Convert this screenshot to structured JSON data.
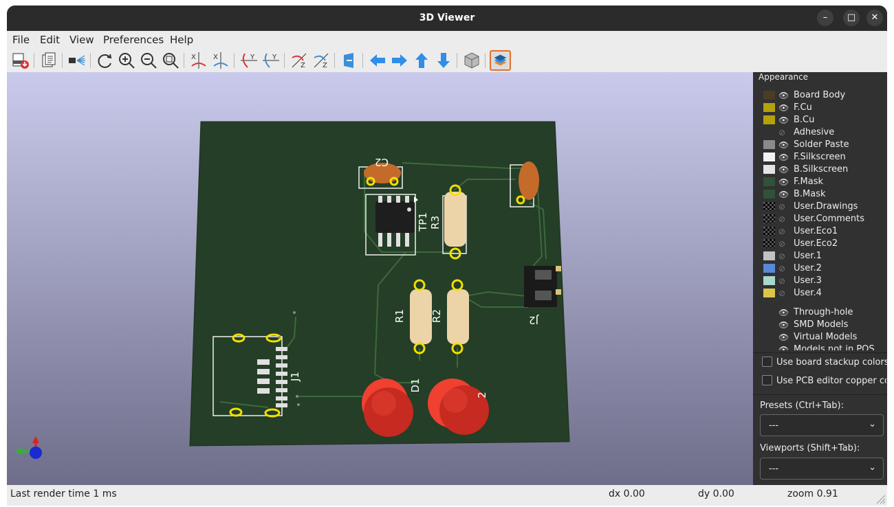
{
  "window": {
    "title": "3D Viewer",
    "controls": {
      "minimize": "–",
      "maximize": "□",
      "close": "✕"
    }
  },
  "menu": [
    "File",
    "Edit",
    "View",
    "Preferences",
    "Help"
  ],
  "toolbar": {
    "icons": [
      "render-raytrace-icon",
      "copy-clipboard-icon",
      "render-mode-icon",
      "reload-board-icon",
      "zoom-in-icon",
      "zoom-out-icon",
      "zoom-fit-icon",
      "rotate-x-cw-icon",
      "rotate-x-ccw-icon",
      "rotate-y-cw-icon",
      "rotate-y-ccw-icon",
      "rotate-z-cw-icon",
      "rotate-z-ccw-icon",
      "flip-board-icon",
      "move-left-icon",
      "move-right-icon",
      "move-up-icon",
      "move-down-icon",
      "ortho-view-icon",
      "show-layers-icon"
    ]
  },
  "pcb": {
    "refdes": {
      "C2": "C2",
      "TP1": "TP1",
      "R3": "R3",
      "R1": "R1",
      "R2": "R2",
      "J1": "J1",
      "D1": "D1",
      "D2": "2",
      "J2": "J2"
    }
  },
  "appearance": {
    "title": "Appearance",
    "layers": [
      {
        "name": "Board Body",
        "color": "#4a3c26",
        "visible": true
      },
      {
        "name": "F.Cu",
        "color": "#b3a20a",
        "visible": true
      },
      {
        "name": "B.Cu",
        "color": "#b3a20a",
        "visible": true
      },
      {
        "name": "Adhesive",
        "color": "",
        "visible": false
      },
      {
        "name": "Solder Paste",
        "color": "#8a8a8a",
        "visible": true
      },
      {
        "name": "F.Silkscreen",
        "color": "#f2f2f2",
        "visible": true
      },
      {
        "name": "B.Silkscreen",
        "color": "#e4e4e4",
        "visible": true
      },
      {
        "name": "F.Mask",
        "color": "#2f5238",
        "visible": true
      },
      {
        "name": "B.Mask",
        "color": "#2f5238",
        "visible": true
      },
      {
        "name": "User.Drawings",
        "color": "checker",
        "visible": false
      },
      {
        "name": "User.Comments",
        "color": "checker",
        "visible": false
      },
      {
        "name": "User.Eco1",
        "color": "checker",
        "visible": false
      },
      {
        "name": "User.Eco2",
        "color": "checker",
        "visible": false
      },
      {
        "name": "User.1",
        "color": "#c2c2c2",
        "visible": false
      },
      {
        "name": "User.2",
        "color": "#5888d8",
        "visible": false
      },
      {
        "name": "User.3",
        "color": "#a8d8cc",
        "visible": false
      },
      {
        "name": "User.4",
        "color": "#dcc44a",
        "visible": false
      }
    ],
    "objects": [
      {
        "name": "Through-hole",
        "visible": true
      },
      {
        "name": "SMD Models",
        "visible": true
      },
      {
        "name": "Virtual Models",
        "visible": true
      },
      {
        "name": "Models not in POS",
        "visible": true
      }
    ],
    "options": {
      "stackup": "Use board stackup colors",
      "copper": "Use PCB editor copper colors"
    },
    "presets": {
      "label": "Presets (Ctrl+Tab):",
      "value": "---"
    },
    "viewports": {
      "label": "Viewports (Shift+Tab):",
      "value": "---"
    }
  },
  "status": {
    "render": "Last render time 1 ms",
    "dx": "dx 0.00",
    "dy": "dy 0.00",
    "zoom": "zoom 0.91"
  }
}
